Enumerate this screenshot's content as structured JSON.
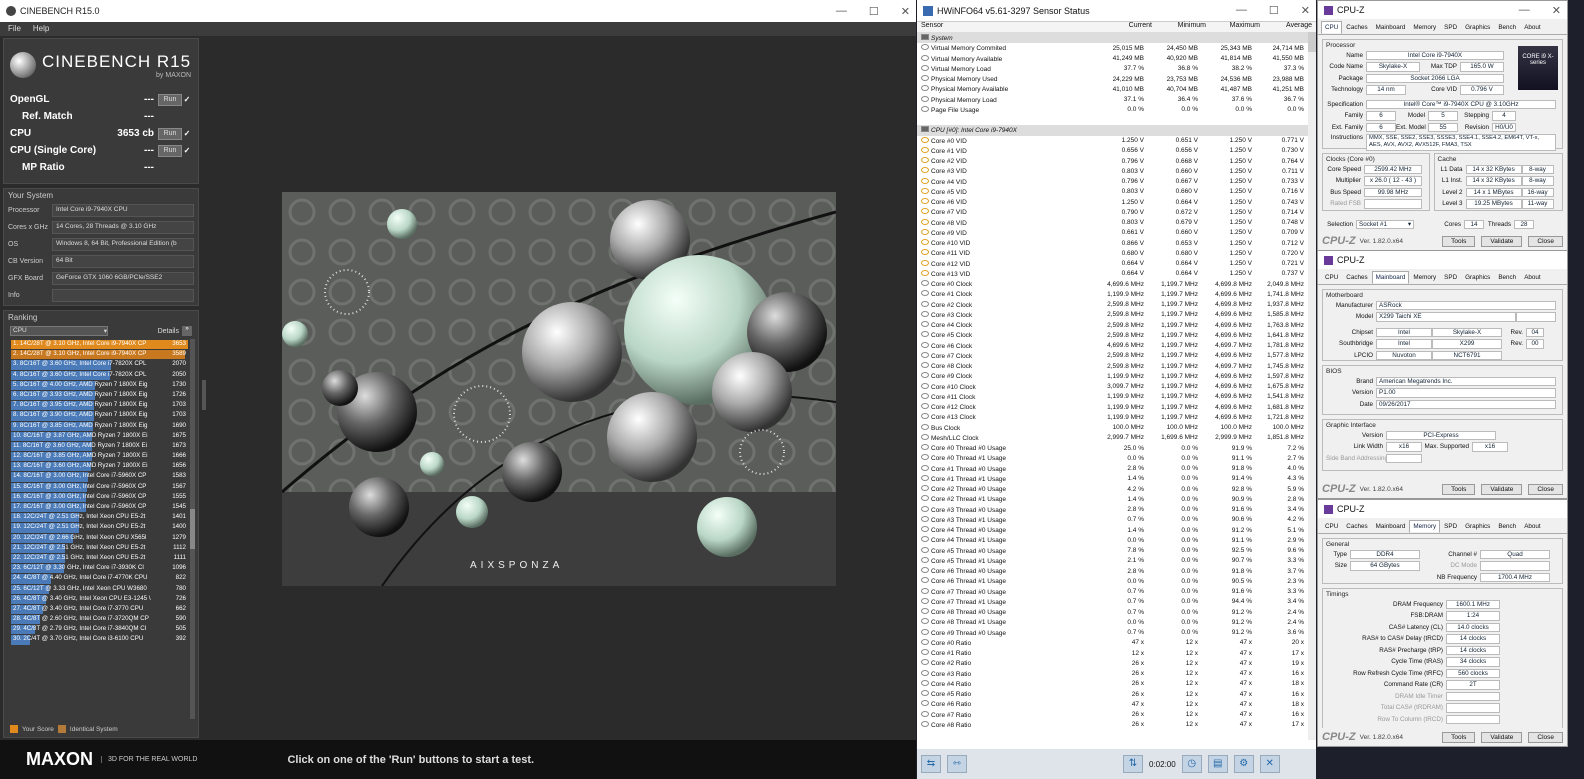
{
  "cinebench": {
    "title": "CINEBENCH R15.0",
    "menu": [
      "File",
      "Help"
    ],
    "logo": "CINEBENCH R15",
    "by": "by MAXON",
    "tests": [
      {
        "label": "OpenGL",
        "score": "---",
        "run": "Run"
      },
      {
        "label": "Ref. Match",
        "score": "---"
      },
      {
        "label": "CPU",
        "score": "3653 cb",
        "run": "Run"
      },
      {
        "label": "CPU (Single Core)",
        "score": "---",
        "run": "Run"
      },
      {
        "label": "MP Ratio",
        "score": "---"
      }
    ],
    "system_title": "Your System",
    "system": [
      {
        "k": "Processor",
        "v": "Intel Core i9-7940X CPU"
      },
      {
        "k": "Cores x GHz",
        "v": "14 Cores, 28 Threads @ 3.10 GHz"
      },
      {
        "k": "OS",
        "v": "Windows 8, 64 Bit, Professional Edition (b"
      },
      {
        "k": "CB Version",
        "v": "64 Bit"
      },
      {
        "k": "GFX Board",
        "v": "GeForce GTX 1060 6GB/PCIe/SSE2"
      },
      {
        "k": "Info",
        "v": ""
      }
    ],
    "ranking_title": "Ranking",
    "ranking_select": "CPU",
    "details": "Details",
    "ranking": [
      {
        "t": "1. 14C/28T @ 3.10 GHz, Intel Core i9-7940X CP",
        "s": "3653",
        "c": "#e08a1e"
      },
      {
        "t": "2. 14C/28T @ 3.10 GHz, Intel Core i9-7940X CP",
        "s": "3589",
        "c": "#c8781e"
      },
      {
        "t": "3. 8C/16T @ 3.60 GHz, Intel Core i7-7820X CPL",
        "s": "2070",
        "c": "#4a7ab8"
      },
      {
        "t": "4. 8C/16T @ 3.60 GHz, Intel Core i7-7820X CPL",
        "s": "2050",
        "c": "#4a7ab8"
      },
      {
        "t": "5. 8C/16T @ 4.00 GHz, AMD Ryzen 7 1800X Eig",
        "s": "1730",
        "c": "#4a7ab8"
      },
      {
        "t": "6. 8C/16T @ 3.93 GHz, AMD Ryzen 7 1800X Eig",
        "s": "1726",
        "c": "#4a7ab8"
      },
      {
        "t": "7. 8C/16T @ 3.95 GHz, AMD Ryzen 7 1800X Eig",
        "s": "1703",
        "c": "#4a7ab8"
      },
      {
        "t": "8. 8C/16T @ 3.90 GHz, AMD Ryzen 7 1800X Eig",
        "s": "1703",
        "c": "#4a7ab8"
      },
      {
        "t": "9. 8C/16T @ 3.85 GHz, AMD Ryzen 7 1800X Eig",
        "s": "1690",
        "c": "#4a7ab8"
      },
      {
        "t": "10. 8C/16T @ 3.87 GHz, AMD Ryzen 7 1800X Ei",
        "s": "1675",
        "c": "#4a7ab8"
      },
      {
        "t": "11. 8C/16T @ 3.60 GHz, AMD Ryzen 7 1800X Ei",
        "s": "1673",
        "c": "#4a7ab8"
      },
      {
        "t": "12. 8C/16T @ 3.85 GHz, AMD Ryzen 7 1800X Ei",
        "s": "1666",
        "c": "#4a7ab8"
      },
      {
        "t": "13. 8C/16T @ 3.60 GHz, AMD Ryzen 7 1800X Ei",
        "s": "1656",
        "c": "#4a7ab8"
      },
      {
        "t": "14. 8C/16T @ 3.00 GHz, Intel Core i7-5960X CP",
        "s": "1583",
        "c": "#4a7ab8"
      },
      {
        "t": "15. 8C/16T @ 3.00 GHz, Intel Core i7-5960X CP",
        "s": "1567",
        "c": "#4a7ab8"
      },
      {
        "t": "16. 8C/16T @ 3.00 GHz, Intel Core i7-5960X CP",
        "s": "1555",
        "c": "#4a7ab8"
      },
      {
        "t": "17. 8C/16T @ 3.00 GHz, Intel Core i7-5960X CP",
        "s": "1545",
        "c": "#4a7ab8"
      },
      {
        "t": "18. 12C/24T @ 2.51 GHz, Intel Xeon CPU E5-2t",
        "s": "1401",
        "c": "#4a7ab8"
      },
      {
        "t": "19. 12C/24T @ 2.51 GHz, Intel Xeon CPU E5-2t",
        "s": "1400",
        "c": "#4a7ab8"
      },
      {
        "t": "20. 12C/24T @ 2.66 GHz, Intel Xeon CPU X565l",
        "s": "1279",
        "c": "#4a7ab8"
      },
      {
        "t": "21. 12C/24T @ 2.51 GHz, Intel Xeon CPU E5-2t",
        "s": "1112",
        "c": "#4a7ab8"
      },
      {
        "t": "22. 12C/24T @ 2.51 GHz, Intel Xeon CPU E5-2t",
        "s": "1111",
        "c": "#4a7ab8"
      },
      {
        "t": "23. 6C/12T @ 3.30 GHz, Intel Core i7-3930K CI",
        "s": "1096",
        "c": "#4a7ab8"
      },
      {
        "t": "24. 4C/8T @ 4.40 GHz, Intel Core i7-4770K CPU",
        "s": "822",
        "c": "#4a7ab8"
      },
      {
        "t": "25. 6C/12T @ 3.33 GHz, Intel Xeon CPU W3680",
        "s": "780",
        "c": "#4a7ab8"
      },
      {
        "t": "26. 4C/8T @ 3.40 GHz, Intel Xeon CPU E3-1245 \\",
        "s": "726",
        "c": "#4a7ab8"
      },
      {
        "t": "27. 4C/8T @ 3.40 GHz, Intel Core i7-3770 CPU",
        "s": "662",
        "c": "#4a7ab8"
      },
      {
        "t": "28. 4C/8T @ 2.60 GHz, Intel Core i7-3720QM CP",
        "s": "590",
        "c": "#4a7ab8"
      },
      {
        "t": "29. 4C/8T @ 2.79 GHz, Intel Core i7-3840QM CI",
        "s": "505",
        "c": "#4a7ab8"
      },
      {
        "t": "30. 2C/4T @ 3.70 GHz, Intel Core i3-6100 CPU",
        "s": "392",
        "c": "#4a7ab8"
      }
    ],
    "legend": [
      "Your Score",
      "Identical System"
    ],
    "brand": "MAXON",
    "tagline": "3D FOR THE REAL WORLD",
    "render_label": "AIXSPONZA",
    "message": "Click on one of the 'Run' buttons to start a test."
  },
  "hwinfo": {
    "title": "HWiNFO64 v5.61-3297 Sensor Status",
    "headers": [
      "Sensor",
      "Current",
      "Minimum",
      "Maximum",
      "Average"
    ],
    "rows": [
      [
        "g",
        "System",
        "",
        "",
        "",
        ""
      ],
      [
        "s",
        "Virtual Memory Commited",
        "25,015 MB",
        "24,450 MB",
        "25,343 MB",
        "24,714 MB"
      ],
      [
        "s",
        "Virtual Memory Available",
        "41,249 MB",
        "40,920 MB",
        "41,814 MB",
        "41,550 MB"
      ],
      [
        "s",
        "Virtual Memory Load",
        "37.7 %",
        "36.8 %",
        "38.2 %",
        "37.3 %"
      ],
      [
        "s",
        "Physical Memory Used",
        "24,229 MB",
        "23,753 MB",
        "24,536 MB",
        "23,988 MB"
      ],
      [
        "s",
        "Physical Memory Available",
        "41,010 MB",
        "40,704 MB",
        "41,487 MB",
        "41,251 MB"
      ],
      [
        "s",
        "Physical Memory Load",
        "37.1 %",
        "36.4 %",
        "37.6 %",
        "36.7 %"
      ],
      [
        "s",
        "Page File Usage",
        "0.0 %",
        "0.0 %",
        "0.0 %",
        "0.0 %"
      ],
      [
        "b",
        "",
        "",
        "",
        "",
        ""
      ],
      [
        "g",
        "CPU [#0]: Intel Core i9-7940X",
        "",
        "",
        "",
        ""
      ],
      [
        "v",
        "Core #0 VID",
        "1.250 V",
        "0.651 V",
        "1.250 V",
        "0.771 V"
      ],
      [
        "v",
        "Core #1 VID",
        "0.656 V",
        "0.656 V",
        "1.250 V",
        "0.730 V"
      ],
      [
        "v",
        "Core #2 VID",
        "0.796 V",
        "0.668 V",
        "1.250 V",
        "0.764 V"
      ],
      [
        "v",
        "Core #3 VID",
        "0.803 V",
        "0.660 V",
        "1.250 V",
        "0.711 V"
      ],
      [
        "v",
        "Core #4 VID",
        "0.796 V",
        "0.667 V",
        "1.250 V",
        "0.733 V"
      ],
      [
        "v",
        "Core #5 VID",
        "0.803 V",
        "0.660 V",
        "1.250 V",
        "0.716 V"
      ],
      [
        "v",
        "Core #6 VID",
        "1.250 V",
        "0.664 V",
        "1.250 V",
        "0.743 V"
      ],
      [
        "v",
        "Core #7 VID",
        "0.790 V",
        "0.672 V",
        "1.250 V",
        "0.714 V"
      ],
      [
        "v",
        "Core #8 VID",
        "0.803 V",
        "0.679 V",
        "1.250 V",
        "0.748 V"
      ],
      [
        "v",
        "Core #9 VID",
        "0.661 V",
        "0.660 V",
        "1.250 V",
        "0.709 V"
      ],
      [
        "v",
        "Core #10 VID",
        "0.866 V",
        "0.653 V",
        "1.250 V",
        "0.712 V"
      ],
      [
        "v",
        "Core #11 VID",
        "0.680 V",
        "0.680 V",
        "1.250 V",
        "0.720 V"
      ],
      [
        "v",
        "Core #12 VID",
        "0.664 V",
        "0.664 V",
        "1.250 V",
        "0.721 V"
      ],
      [
        "v",
        "Core #13 VID",
        "0.664 V",
        "0.664 V",
        "1.250 V",
        "0.737 V"
      ],
      [
        "c",
        "Core #0 Clock",
        "4,699.6 MHz",
        "1,199.7 MHz",
        "4,699.8 MHz",
        "2,049.8 MHz"
      ],
      [
        "c",
        "Core #1 Clock",
        "1,199.9 MHz",
        "1,199.7 MHz",
        "4,699.6 MHz",
        "1,741.8 MHz"
      ],
      [
        "c",
        "Core #2 Clock",
        "2,599.8 MHz",
        "1,199.7 MHz",
        "4,699.8 MHz",
        "1,937.8 MHz"
      ],
      [
        "c",
        "Core #3 Clock",
        "2,599.8 MHz",
        "1,199.7 MHz",
        "4,699.6 MHz",
        "1,585.8 MHz"
      ],
      [
        "c",
        "Core #4 Clock",
        "2,599.8 MHz",
        "1,199.7 MHz",
        "4,699.6 MHz",
        "1,763.8 MHz"
      ],
      [
        "c",
        "Core #5 Clock",
        "2,599.8 MHz",
        "1,199.7 MHz",
        "4,699.6 MHz",
        "1,641.8 MHz"
      ],
      [
        "c",
        "Core #6 Clock",
        "4,699.6 MHz",
        "1,199.7 MHz",
        "4,699.7 MHz",
        "1,781.8 MHz"
      ],
      [
        "c",
        "Core #7 Clock",
        "2,599.8 MHz",
        "1,199.7 MHz",
        "4,699.6 MHz",
        "1,577.8 MHz"
      ],
      [
        "c",
        "Core #8 Clock",
        "2,599.8 MHz",
        "1,199.7 MHz",
        "4,699.7 MHz",
        "1,745.8 MHz"
      ],
      [
        "c",
        "Core #9 Clock",
        "1,199.9 MHz",
        "1,199.7 MHz",
        "4,699.6 MHz",
        "1,597.8 MHz"
      ],
      [
        "c",
        "Core #10 Clock",
        "3,099.7 MHz",
        "1,199.7 MHz",
        "4,699.6 MHz",
        "1,675.8 MHz"
      ],
      [
        "c",
        "Core #11 Clock",
        "1,199.9 MHz",
        "1,199.7 MHz",
        "4,699.6 MHz",
        "1,541.8 MHz"
      ],
      [
        "c",
        "Core #12 Clock",
        "1,199.9 MHz",
        "1,199.7 MHz",
        "4,699.6 MHz",
        "1,681.8 MHz"
      ],
      [
        "c",
        "Core #13 Clock",
        "1,199.9 MHz",
        "1,199.7 MHz",
        "4,699.6 MHz",
        "1,721.8 MHz"
      ],
      [
        "c",
        "Bus Clock",
        "100.0 MHz",
        "100.0 MHz",
        "100.0 MHz",
        "100.0 MHz"
      ],
      [
        "c",
        "Mesh/LLC Clock",
        "2,999.7 MHz",
        "1,699.6 MHz",
        "2,999.9 MHz",
        "1,851.8 MHz"
      ],
      [
        "c",
        "Core #0 Thread #0 Usage",
        "25.0 %",
        "0.0 %",
        "91.9 %",
        "7.2 %"
      ],
      [
        "c",
        "Core #0 Thread #1 Usage",
        "0.0 %",
        "0.0 %",
        "91.1 %",
        "2.7 %"
      ],
      [
        "c",
        "Core #1 Thread #0 Usage",
        "2.8 %",
        "0.0 %",
        "91.8 %",
        "4.0 %"
      ],
      [
        "c",
        "Core #1 Thread #1 Usage",
        "1.4 %",
        "0.0 %",
        "91.4 %",
        "4.3 %"
      ],
      [
        "c",
        "Core #2 Thread #0 Usage",
        "4.2 %",
        "0.0 %",
        "92.8 %",
        "5.9 %"
      ],
      [
        "c",
        "Core #2 Thread #1 Usage",
        "1.4 %",
        "0.0 %",
        "90.9 %",
        "2.8 %"
      ],
      [
        "c",
        "Core #3 Thread #0 Usage",
        "2.8 %",
        "0.0 %",
        "91.6 %",
        "3.4 %"
      ],
      [
        "c",
        "Core #3 Thread #1 Usage",
        "0.7 %",
        "0.0 %",
        "90.6 %",
        "4.2 %"
      ],
      [
        "c",
        "Core #4 Thread #0 Usage",
        "1.4 %",
        "0.0 %",
        "91.2 %",
        "5.1 %"
      ],
      [
        "c",
        "Core #4 Thread #1 Usage",
        "0.0 %",
        "0.0 %",
        "91.1 %",
        "2.9 %"
      ],
      [
        "c",
        "Core #5 Thread #0 Usage",
        "7.8 %",
        "0.0 %",
        "92.5 %",
        "9.6 %"
      ],
      [
        "c",
        "Core #5 Thread #1 Usage",
        "2.1 %",
        "0.0 %",
        "90.7 %",
        "3.3 %"
      ],
      [
        "c",
        "Core #6 Thread #0 Usage",
        "2.8 %",
        "0.0 %",
        "91.8 %",
        "3.7 %"
      ],
      [
        "c",
        "Core #6 Thread #1 Usage",
        "0.0 %",
        "0.0 %",
        "90.5 %",
        "2.3 %"
      ],
      [
        "c",
        "Core #7 Thread #0 Usage",
        "0.7 %",
        "0.0 %",
        "91.6 %",
        "3.3 %"
      ],
      [
        "c",
        "Core #7 Thread #1 Usage",
        "0.7 %",
        "0.0 %",
        "94.4 %",
        "3.4 %"
      ],
      [
        "c",
        "Core #8 Thread #0 Usage",
        "0.7 %",
        "0.0 %",
        "91.2 %",
        "2.4 %"
      ],
      [
        "c",
        "Core #8 Thread #1 Usage",
        "0.0 %",
        "0.0 %",
        "91.2 %",
        "2.4 %"
      ],
      [
        "c",
        "Core #9 Thread #0 Usage",
        "0.7 %",
        "0.0 %",
        "91.2 %",
        "3.6 %"
      ],
      [
        "c",
        "Core #0 Ratio",
        "47 x",
        "12 x",
        "47 x",
        "20 x"
      ],
      [
        "c",
        "Core #1 Ratio",
        "12 x",
        "12 x",
        "47 x",
        "17 x"
      ],
      [
        "c",
        "Core #2 Ratio",
        "26 x",
        "12 x",
        "47 x",
        "19 x"
      ],
      [
        "c",
        "Core #3 Ratio",
        "26 x",
        "12 x",
        "47 x",
        "16 x"
      ],
      [
        "c",
        "Core #4 Ratio",
        "26 x",
        "12 x",
        "47 x",
        "18 x"
      ],
      [
        "c",
        "Core #5 Ratio",
        "26 x",
        "12 x",
        "47 x",
        "16 x"
      ],
      [
        "c",
        "Core #6 Ratio",
        "47 x",
        "12 x",
        "47 x",
        "18 x"
      ],
      [
        "c",
        "Core #7 Ratio",
        "26 x",
        "12 x",
        "47 x",
        "16 x"
      ],
      [
        "c",
        "Core #8 Ratio",
        "26 x",
        "12 x",
        "47 x",
        "17 x"
      ]
    ],
    "timer": "0:02:00"
  },
  "cpuz": {
    "title": "CPU-Z",
    "version": "Ver. 1.82.0.x64",
    "tools": "Tools",
    "validate": "Validate",
    "close": "Close",
    "tabs": [
      "CPU",
      "Caches",
      "Mainboard",
      "Memory",
      "SPD",
      "Graphics",
      "Bench",
      "About"
    ],
    "cpu": {
      "group": "Processor",
      "name": "Intel Core i9-7940X",
      "code_name": "Skylake-X",
      "max_tdp": "165.0 W",
      "package": "Socket 2066 LGA",
      "technology": "14 nm",
      "core_vid": "0.796 V",
      "spec": "Intel® Core™ i9-7940X CPU @ 3.10GHz",
      "family": "6",
      "model": "5",
      "stepping": "4",
      "ext_family": "6",
      "ext_model": "55",
      "revision": "H0/U0",
      "instructions": "MMX, SSE, SSE2, SSE3, SSSE3, SSE4.1, SSE4.2, EM64T, VT-x, AES, AVX, AVX2, AVX512F, FMA3, TSX",
      "clocks_title": "Clocks (Core #0)",
      "core_speed": "2599.42 MHz",
      "multiplier": "x 26.0 ( 12 - 43 )",
      "bus_speed": "99.98 MHz",
      "rated_fsb": "",
      "cache_title": "Cache",
      "l1d": "14 x 32 KBytes",
      "l1d_w": "8-way",
      "l1i": "14 x 32 KBytes",
      "l1i_w": "8-way",
      "l2": "14 x 1 MBytes",
      "l2_w": "16-way",
      "l3": "19.25 MBytes",
      "l3_w": "11-way",
      "selection": "Socket #1",
      "cores": "14",
      "threads": "28",
      "chip_text": "CORE i9 X-series"
    },
    "mb": {
      "group": "Motherboard",
      "manufacturer": "ASRock",
      "model": "X299 Taichi XE",
      "chipset": "Intel",
      "chipset2": "Skylake-X",
      "chipset_rev": "04",
      "south": "Intel",
      "south2": "X299",
      "south_rev": "00",
      "lpcio": "Nuvoton",
      "lpcio2": "NCT6791",
      "bios_title": "BIOS",
      "brand": "American Megatrends Inc.",
      "bversion": "P1.00",
      "date": "09/26/2017",
      "gi_title": "Graphic Interface",
      "gi_version": "PCI-Express",
      "link_width": "x16",
      "max_supported": "x16",
      "side_band": ""
    },
    "mem": {
      "general": "General",
      "type": "DDR4",
      "channel": "Quad",
      "size": "64 GBytes",
      "dc_mode": "",
      "nb_freq": "1700.4 MHz",
      "timings_title": "Timings",
      "dram_freq": "1600.1 MHz",
      "fsb_dram": "1:24",
      "cl": "14.0 clocks",
      "trcd": "14 clocks",
      "trp": "14 clocks",
      "tras": "34 clocks",
      "trfc": "560 clocks",
      "cr": "2T",
      "idle": "",
      "total_cas": "",
      "row_to_col": ""
    },
    "labels": {
      "name": "Name",
      "code_name": "Code Name",
      "max_tdp": "Max TDP",
      "package": "Package",
      "technology": "Technology",
      "core_vid": "Core VID",
      "spec": "Specification",
      "family": "Family",
      "model": "Model",
      "stepping": "Stepping",
      "ext_family": "Ext. Family",
      "ext_model": "Ext. Model",
      "revision": "Revision",
      "instructions": "Instructions",
      "core_speed": "Core Speed",
      "multiplier": "Multiplier",
      "bus_speed": "Bus Speed",
      "rated_fsb": "Rated FSB",
      "l1d": "L1 Data",
      "l1i": "L1 Inst.",
      "l2": "Level 2",
      "l3": "Level 3",
      "selection": "Selection",
      "cores": "Cores",
      "threads": "Threads",
      "manufacturer": "Manufacturer",
      "mbmodel": "Model",
      "chipset": "Chipset",
      "south": "Southbridge",
      "lpcio": "LPCIO",
      "rev": "Rev.",
      "brand": "Brand",
      "bversion": "Version",
      "date": "Date",
      "gi_version": "Version",
      "link_width": "Link Width",
      "max_supported": "Max. Supported",
      "side_band": "Side Band Addressing",
      "type": "Type",
      "channel": "Channel #",
      "size": "Size",
      "dc_mode": "DC Mode",
      "nb_freq": "NB Frequency",
      "dram_freq": "DRAM Frequency",
      "fsb_dram": "FSB:DRAM",
      "cl": "CAS# Latency (CL)",
      "trcd": "RAS# to CAS# Delay (tRCD)",
      "trp": "RAS# Precharge (tRP)",
      "tras": "Cycle Time (tRAS)",
      "trfc": "Row Refresh Cycle Time (tRFC)",
      "cr": "Command Rate (CR)",
      "idle": "DRAM Idle Timer",
      "total_cas": "Total CAS# (tRDRAM)",
      "row_to_col": "Row To Column (tRCD)"
    }
  }
}
